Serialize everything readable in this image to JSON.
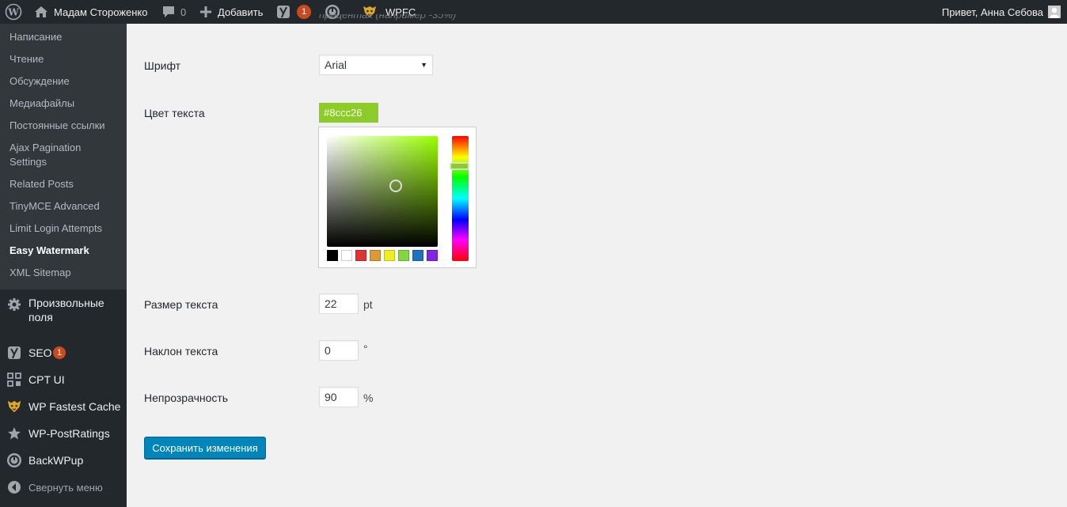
{
  "adminbar": {
    "site_name": "Мадам Стороженко",
    "comments_count": "0",
    "add_label": "Добавить",
    "yoast_badge": "1",
    "wpfc_label": "WPFC",
    "greeting": "Привет, Анна Себова",
    "icons": [
      "wordpress-logo-icon",
      "home-icon",
      "comment-icon",
      "plus-icon",
      "yoast-icon",
      "backwpup-icon",
      "wpfc-tiger-icon",
      "avatar"
    ]
  },
  "sidebar": {
    "submenu": [
      {
        "label": "Написание"
      },
      {
        "label": "Чтение"
      },
      {
        "label": "Обсуждение"
      },
      {
        "label": "Медиафайлы"
      },
      {
        "label": "Постоянные ссылки"
      },
      {
        "label": "Ajax Pagination Settings"
      },
      {
        "label": "Related Posts"
      },
      {
        "label": "TinyMCE Advanced"
      },
      {
        "label": "Limit Login Attempts"
      },
      {
        "label": "Easy Watermark"
      },
      {
        "label": "XML Sitemap"
      }
    ],
    "menu": [
      {
        "label": "Произвольные поля",
        "icon": "gear-icon"
      },
      {
        "label": "SEO",
        "badge": "1",
        "icon": "yoast-icon"
      },
      {
        "label": "CPT UI",
        "icon": "grid-icon"
      },
      {
        "label": "WP Fastest Cache",
        "icon": "wpfc-tiger-icon"
      },
      {
        "label": "WP-PostRatings",
        "icon": "star-icon"
      },
      {
        "label": "BackWPup",
        "icon": "backwpup-icon"
      },
      {
        "label": "Свернуть меню",
        "icon": "collapse-icon"
      }
    ]
  },
  "form": {
    "cut_text": "процентах (например -35%)",
    "font": {
      "label": "Шрифт",
      "value": "Arial"
    },
    "text_color": {
      "label": "Цвет текста",
      "value": "#8ccc26"
    },
    "palette": [
      "#000000",
      "#ffffff",
      "#dd3333",
      "#dd9933",
      "#eeee22",
      "#81d742",
      "#1e73be",
      "#8224e3"
    ],
    "text_size": {
      "label": "Размер текста",
      "value": "22",
      "unit": "pt"
    },
    "text_angle": {
      "label": "Наклон текста",
      "value": "0",
      "unit": "°"
    },
    "opacity": {
      "label": "Непрозрачность",
      "value": "90",
      "unit": "%"
    },
    "save_label": "Сохранить изменения"
  },
  "colors": {
    "accent": "#0085ba",
    "adminbar_bg": "#23282d",
    "submenu_bg": "#32373c",
    "badge": "#ca4a1f"
  }
}
